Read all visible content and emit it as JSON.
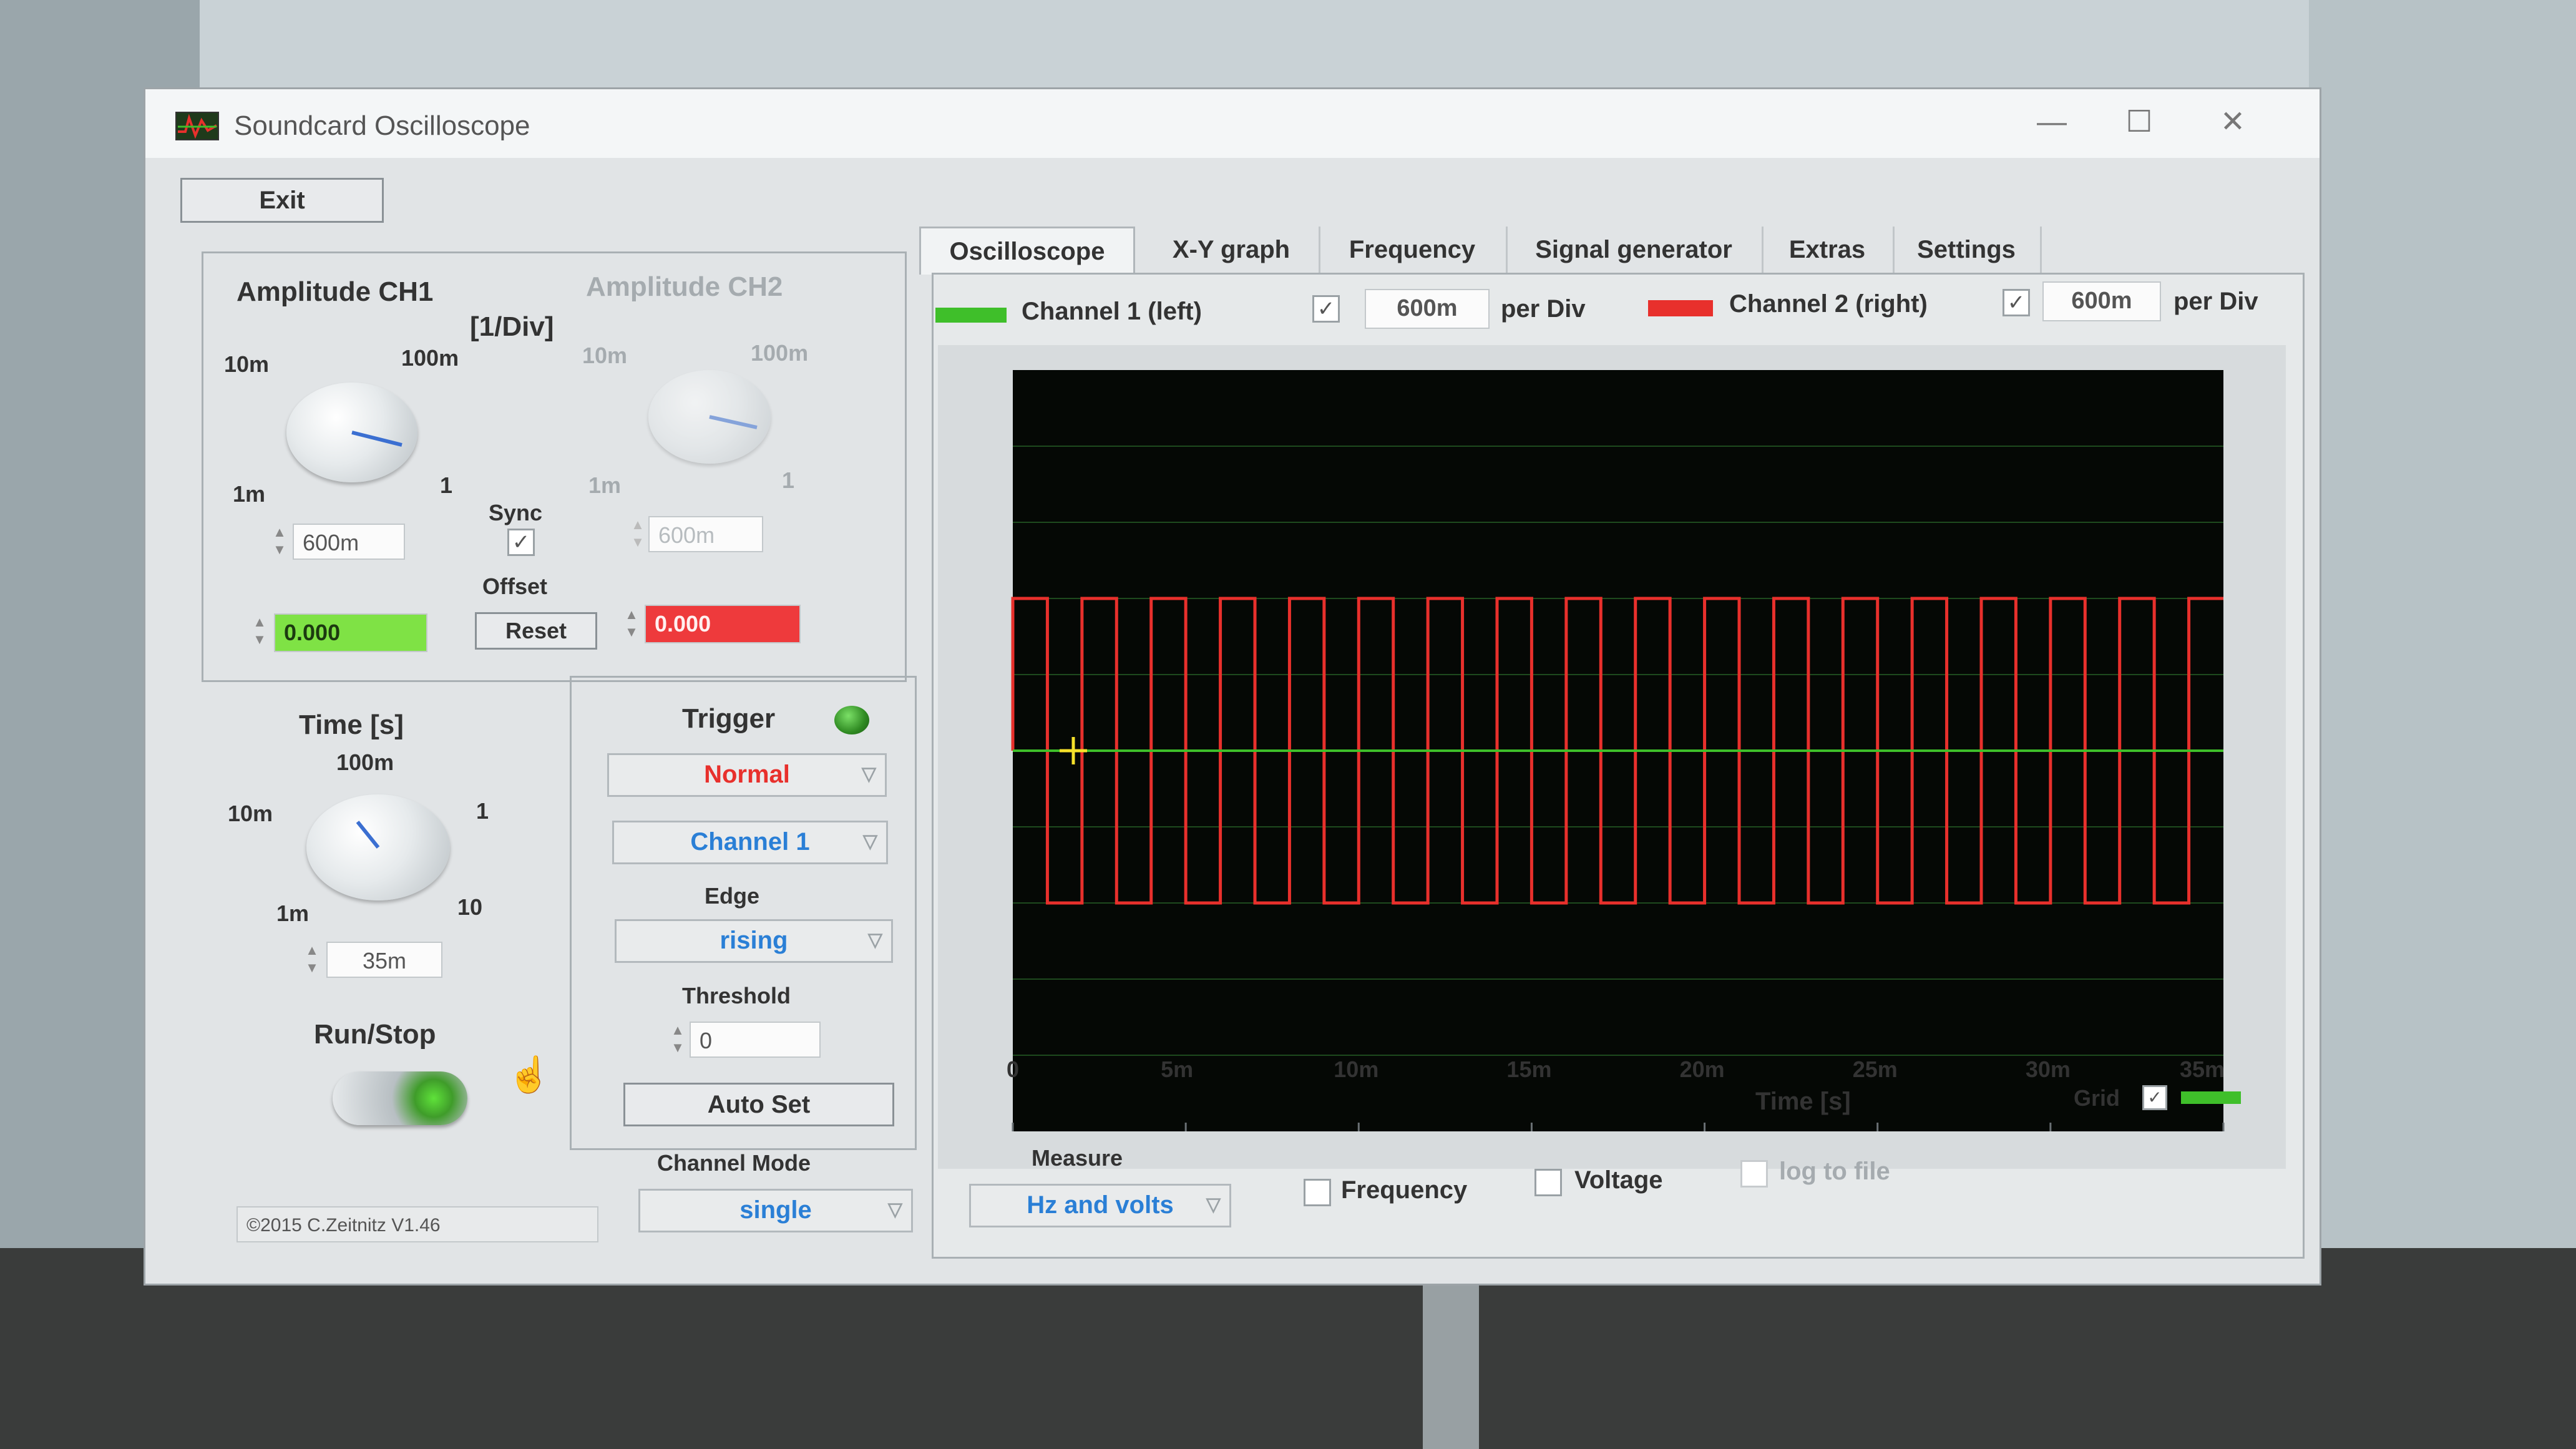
{
  "window": {
    "title": "Soundcard Oscilloscope",
    "minimize": "—",
    "maximize": "☐",
    "close": "✕"
  },
  "toolbar": {
    "exit_label": "Exit"
  },
  "amplitude": {
    "ch1_title": "Amplitude CH1",
    "ch2_title": "Amplitude CH2",
    "unit": "[1/Div]",
    "ch1_ticks": {
      "t10m": "10m",
      "t100m": "100m",
      "t1m": "1m",
      "t1": "1"
    },
    "ch2_ticks": {
      "t10m": "10m",
      "t100m": "100m",
      "t1m": "1m",
      "t1": "1"
    },
    "ch1_value": "600m",
    "ch2_value": "600m",
    "sync_label": "Sync",
    "offset_label": "Offset",
    "ch1_offset": "0.000",
    "ch2_offset": "0.000",
    "reset_label": "Reset"
  },
  "time": {
    "title": "Time [s]",
    "ticks": {
      "t100m": "100m",
      "t10m": "10m",
      "t1": "1",
      "t1m": "1m",
      "t10": "10"
    },
    "value": "35m"
  },
  "runstop": {
    "label": "Run/Stop"
  },
  "copyright": "©2015  C.Zeitnitz V1.46",
  "trigger": {
    "title": "Trigger",
    "mode": "Normal",
    "channel": "Channel 1",
    "edge_label": "Edge",
    "edge": "rising",
    "threshold_label": "Threshold",
    "threshold": "0",
    "autoset_label": "Auto Set"
  },
  "channel_mode": {
    "label": "Channel Mode",
    "value": "single"
  },
  "tabs": [
    "Oscilloscope",
    "X-Y graph",
    "Frequency",
    "Signal generator",
    "Extras",
    "Settings"
  ],
  "channels": {
    "ch1_label": "Channel 1 (left)",
    "ch1_per_div": "600m",
    "ch2_label": "Channel 2 (right)",
    "ch2_per_div": "600m",
    "per_div": "per Div"
  },
  "scope": {
    "x_ticks": [
      "0",
      "5m",
      "10m",
      "15m",
      "20m",
      "25m",
      "30m",
      "35m"
    ],
    "xlabel": "Time [s]",
    "grid_label": "Grid"
  },
  "measure": {
    "label": "Measure",
    "mode": "Hz and volts",
    "frequency_label": "Frequency",
    "voltage_label": "Voltage",
    "log_label": "log to file"
  },
  "colors": {
    "ch1": "#3fbf2a",
    "ch2": "#e8302c",
    "screen": "#050805",
    "grid": "#1e4a1e"
  },
  "chart_data": {
    "type": "line",
    "xlim": [
      0,
      35
    ],
    "x_unit": "ms",
    "grid": true,
    "series": [
      {
        "name": "Channel 1 (left)",
        "shape": "flat",
        "level": 0
      },
      {
        "name": "Channel 2 (right)",
        "shape": "square",
        "cycles": 17.5,
        "high": 1.0,
        "low": -1.0
      }
    ]
  }
}
